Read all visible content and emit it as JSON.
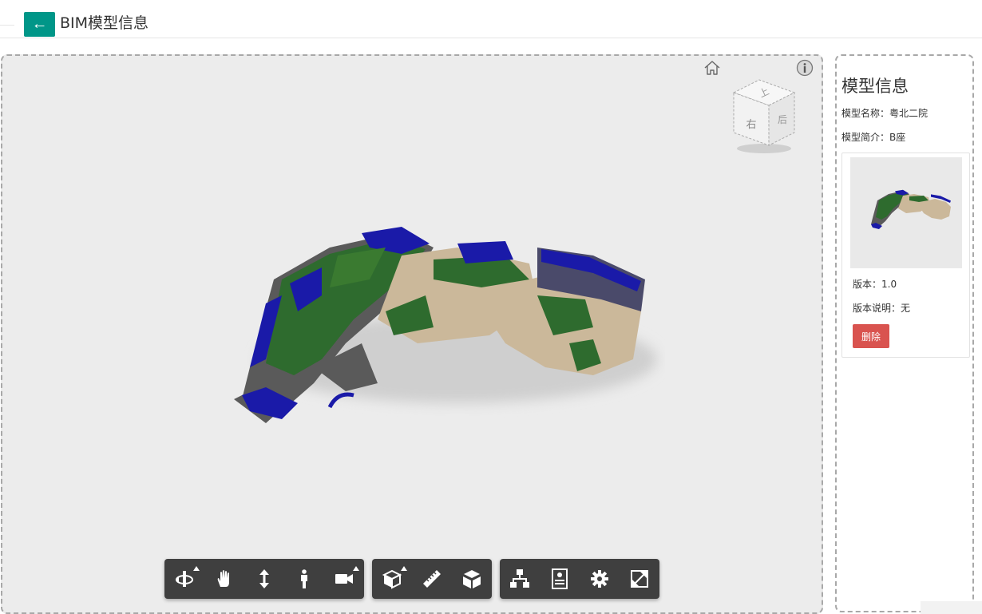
{
  "header": {
    "back_icon": "arrow-left-icon",
    "back_symbol": "←",
    "title": "BIM模型信息"
  },
  "viewer": {
    "viewcube": {
      "top_face": "上",
      "front_face": "右",
      "side_face": "后"
    },
    "toolbar_groups": [
      [
        "orbit-icon",
        "pan-icon",
        "zoom-icon",
        "first-person-icon",
        "camera-icon"
      ],
      [
        "section-box-icon",
        "measure-icon",
        "explode-icon"
      ],
      [
        "model-tree-icon",
        "properties-icon",
        "settings-icon",
        "fullscreen-icon"
      ]
    ]
  },
  "panel": {
    "title": "模型信息",
    "model_name": "模型名称：粤北二院",
    "model_intro": "模型简介：B座",
    "version": {
      "number": "版本：1.0",
      "description": "版本说明：无",
      "delete_label": "删除"
    }
  },
  "colors": {
    "accent": "#009688",
    "danger": "#d9534f",
    "toolbar": "#3f3f3f",
    "viewer_bg": "#ececec"
  }
}
